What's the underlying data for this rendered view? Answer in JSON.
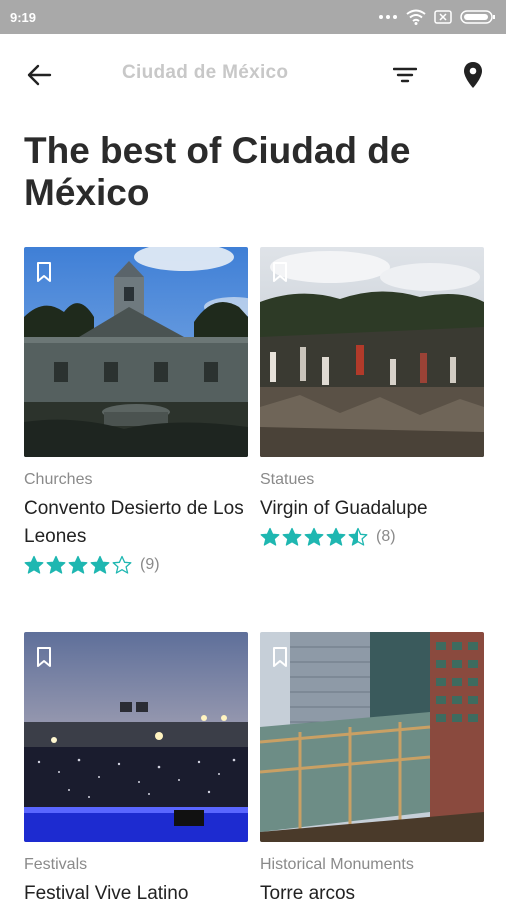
{
  "status": {
    "time": "9:19"
  },
  "appbar": {
    "title": "Ciudad de México"
  },
  "headline": "The best of Ciudad de México",
  "cards": [
    {
      "category": "Churches",
      "name": "Convento Desierto de Los Leones",
      "rating": 4,
      "reviews": "(9)"
    },
    {
      "category": "Statues",
      "name": "Virgin of Guadalupe",
      "rating": 4.5,
      "reviews": "(8)"
    },
    {
      "category": "Festivals",
      "name": "Festival Vive Latino"
    },
    {
      "category": "Historical Monuments",
      "name": "Torre arcos"
    }
  ],
  "colors": {
    "star": "#1fb7b1",
    "status_bar": "#a9a9a9"
  },
  "icons": {
    "back": "arrow-left-icon",
    "filter": "filter-icon",
    "map": "location-pin-icon",
    "save": "bookmark-icon"
  }
}
